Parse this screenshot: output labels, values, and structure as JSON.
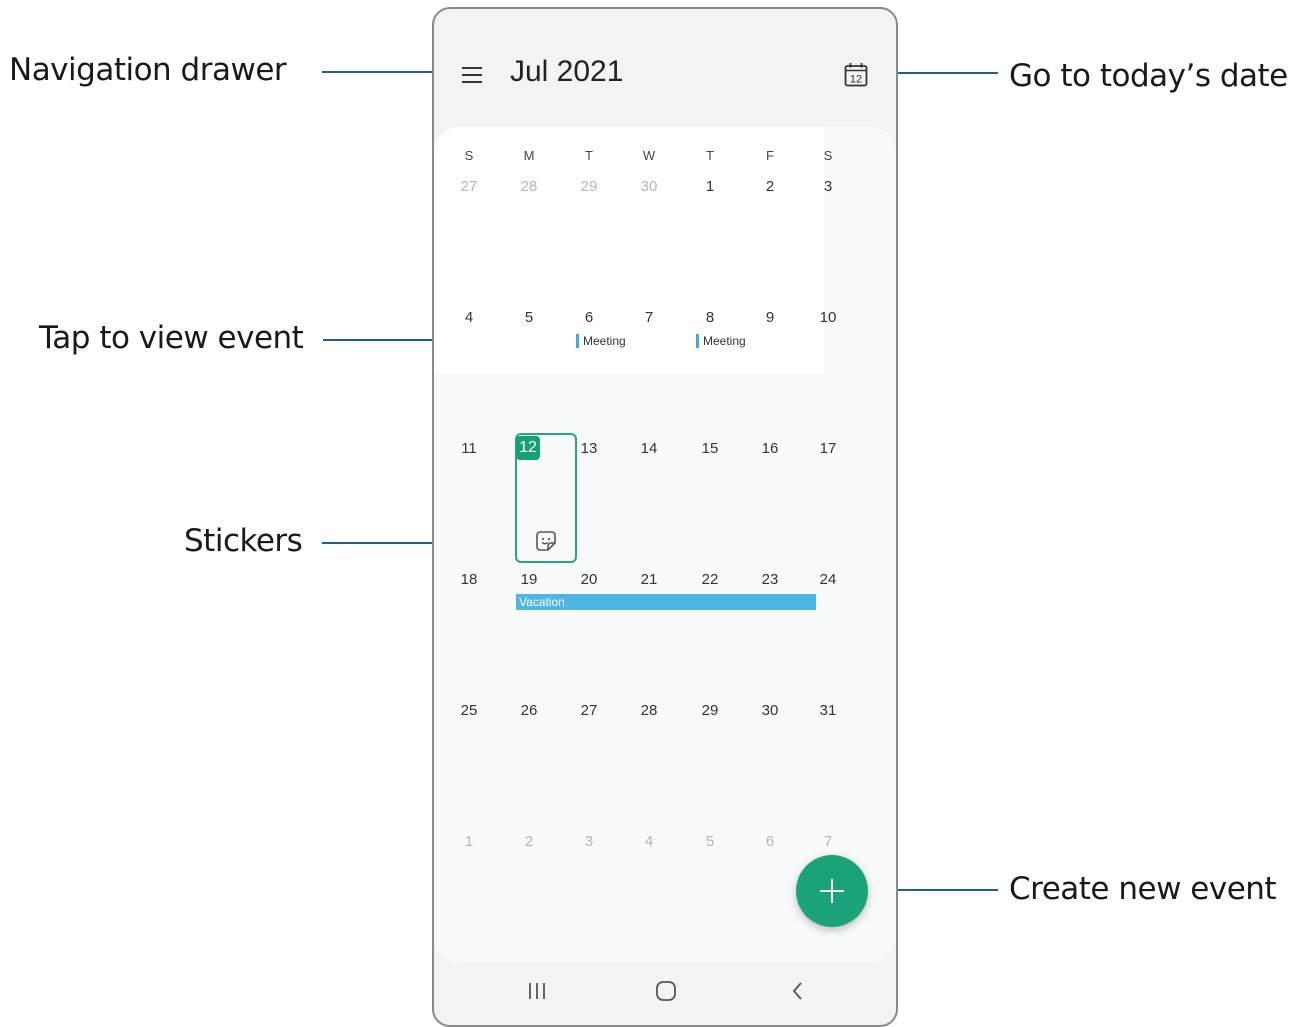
{
  "callouts": {
    "navigation_drawer": "Navigation drawer",
    "go_to_today": "Go to today’s date",
    "tap_to_view_event": "Tap to view event",
    "stickers": "Stickers",
    "create_new_event": "Create new event"
  },
  "header": {
    "title": "Jul 2021",
    "today_icon_day": "12"
  },
  "weekdays": [
    "S",
    "M",
    "T",
    "W",
    "T",
    "F",
    "S"
  ],
  "weeks": [
    [
      "27",
      "28",
      "29",
      "30",
      "1",
      "2",
      "3"
    ],
    [
      "4",
      "5",
      "6",
      "7",
      "8",
      "9",
      "10"
    ],
    [
      "11",
      "12",
      "13",
      "14",
      "15",
      "16",
      "17"
    ],
    [
      "18",
      "19",
      "20",
      "21",
      "22",
      "23",
      "24"
    ],
    [
      "25",
      "26",
      "27",
      "28",
      "29",
      "30",
      "31"
    ],
    [
      "1",
      "2",
      "3",
      "4",
      "5",
      "6",
      "7"
    ]
  ],
  "events": {
    "meeting_1": "Meeting",
    "meeting_2": "Meeting",
    "vacation": "Vacation"
  },
  "colors": {
    "accent": "#1aa27a",
    "event_bar": "#4db6e2",
    "callout_line": "#1f5f8b"
  },
  "icons": {
    "menu": "hamburger-icon",
    "today": "calendar-today-icon",
    "sticker": "sticker-icon",
    "add": "plus-icon",
    "recents": "recents-icon",
    "home": "home-icon",
    "back": "back-icon"
  }
}
